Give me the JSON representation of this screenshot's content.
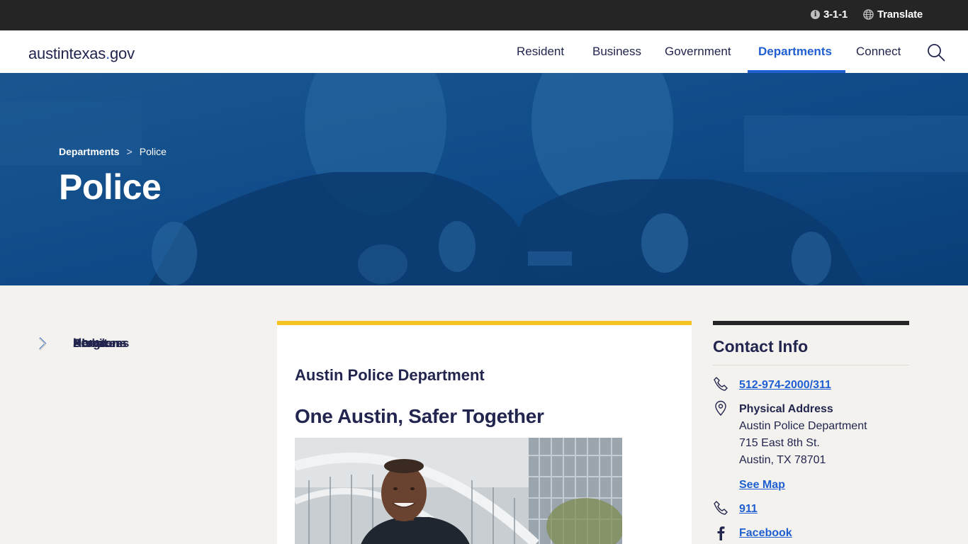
{
  "utility": {
    "info_glyph": "i",
    "phone_311": "3-1-1",
    "translate": "Translate"
  },
  "header": {
    "logo_main": "austintexas",
    "logo_dot": ".",
    "logo_tld": "gov",
    "nav": {
      "resident": "Resident",
      "business": "Business",
      "government": "Government",
      "departments": "Departments",
      "connect": "Connect"
    },
    "active_nav": "Departments"
  },
  "hero": {
    "breadcrumb": {
      "parent": "Departments",
      "separator": ">",
      "current": "Police"
    },
    "title": "Police"
  },
  "sidebar": {
    "items": [
      {
        "label": "Home"
      },
      {
        "label": "About"
      },
      {
        "label": "Services"
      },
      {
        "label": "Programs"
      },
      {
        "label": "Divisions"
      }
    ]
  },
  "main": {
    "department_name": "Austin Police Department",
    "tagline": "One Austin, Safer Together"
  },
  "contact": {
    "title": "Contact Info",
    "phone": "512-974-2000/311",
    "address_label": "Physical Address",
    "address_line1": "Austin Police Department",
    "address_line2": "715 East 8th St.",
    "address_line3": "Austin, TX 78701",
    "map_link": "See Map",
    "emergency": "911",
    "facebook": "Facebook"
  },
  "colors": {
    "accent_blue": "#1f5fd1",
    "hero_blue": "#0e4a86",
    "card_top_yellow": "#f6c423",
    "utility_bar": "#252525"
  }
}
